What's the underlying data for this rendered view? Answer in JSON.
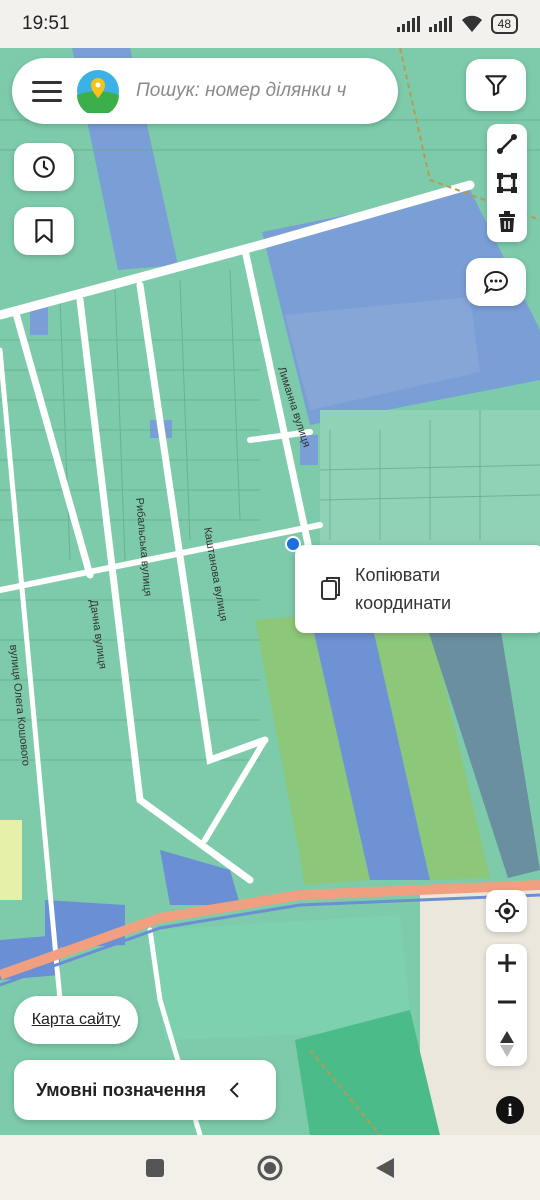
{
  "status_bar": {
    "time": "19:51",
    "battery": "48"
  },
  "search": {
    "placeholder": "Пошук: номер ділянки чи адреса"
  },
  "map": {
    "street_labels": [
      "Лиманна вулиця",
      "Рибальська вулиця",
      "Каштанова вулиця",
      "Дачна вулиця",
      "вулиця Олега Кошового"
    ]
  },
  "context_menu": {
    "copy_coordinates": "Копіювати координати"
  },
  "footer": {
    "site_map": "Карта сайту",
    "legend": "Умовні позначення"
  },
  "info": {
    "label": "i"
  },
  "colors": {
    "parcel_green": "#7dcbaa",
    "parcel_blue": "#7a9fd6",
    "road_red": "#f0a080",
    "accent_blue": "#1e6fe0"
  }
}
